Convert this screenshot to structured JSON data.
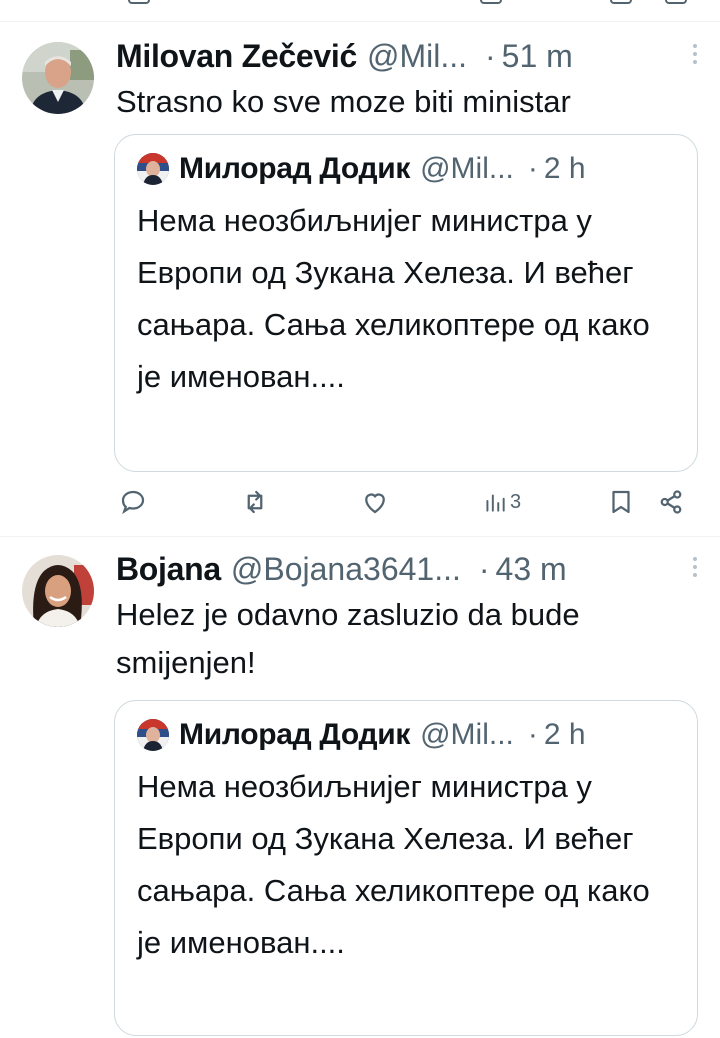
{
  "tweets": [
    {
      "author": "Milovan Zečević",
      "handle": "@Mil...",
      "separator": "·",
      "time": "51 m",
      "text": "Strasno ko sve moze biti ministar",
      "quote": {
        "author": "Милорад Додик",
        "handle": "@Mil...",
        "separator": "·",
        "time": "2 h",
        "text": "Нема неозбиљнијег министра у Европи од Зукана Хелеза. И већег сањара. Сања хеликоптере од како је именован...."
      },
      "actions": {
        "views_count": "3"
      }
    },
    {
      "author": "Bojana",
      "handle": "@Bojana3641...",
      "separator": "·",
      "time": "43 m",
      "text": "Helez je odavno zasluzio da bude smijenjen!",
      "quote": {
        "author": "Милорад Додик",
        "handle": "@Mil...",
        "separator": "·",
        "time": "2 h",
        "text": "Нема неозбиљнијег министра у Европи од Зукана Хелеза. И већег сањара. Сања хеликоптере од како је именован...."
      }
    }
  ],
  "colors": {
    "text_primary": "#0f1419",
    "text_secondary": "#536471",
    "border": "#cfd9de",
    "divider": "#eff3f4"
  },
  "icons": {
    "reply": "reply-icon",
    "retweet": "retweet-icon",
    "like": "like-icon",
    "views": "views-icon",
    "bookmark": "bookmark-icon",
    "share": "share-icon",
    "more": "more-icon"
  }
}
